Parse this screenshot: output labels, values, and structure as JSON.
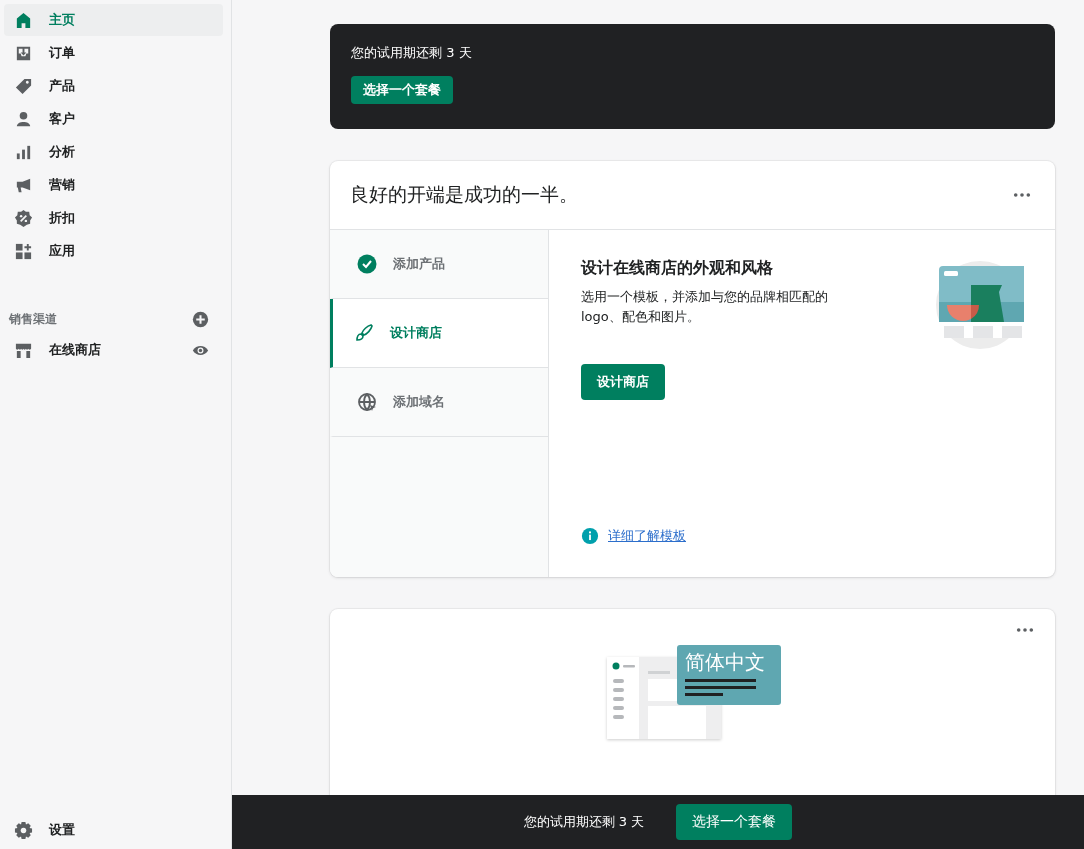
{
  "sidebar": {
    "items": [
      {
        "label": "主页",
        "selected": true
      },
      {
        "label": "订单",
        "selected": false
      },
      {
        "label": "产品",
        "selected": false
      },
      {
        "label": "客户",
        "selected": false
      },
      {
        "label": "分析",
        "selected": false
      },
      {
        "label": "营销",
        "selected": false
      },
      {
        "label": "折扣",
        "selected": false
      },
      {
        "label": "应用",
        "selected": false
      }
    ],
    "section": {
      "title": "销售渠道",
      "items": [
        {
          "label": "在线商店",
          "selected": false
        }
      ]
    },
    "settings": {
      "label": "设置"
    }
  },
  "trial_banner": {
    "text": "您的试用期还剩 3 天",
    "button": "选择一个套餐"
  },
  "setup_card": {
    "title": "良好的开端是成功的一半。",
    "steps": [
      {
        "label": "添加产品",
        "done": true,
        "selected": false
      },
      {
        "label": "设计商店",
        "done": false,
        "selected": true
      },
      {
        "label": "添加域名",
        "done": false,
        "selected": false
      }
    ],
    "detail": {
      "title": "设计在线商店的外观和风格",
      "body": "选用一个模板，并添加与您的品牌相匹配的 logo、配色和图片。",
      "button": "设计商店",
      "link": "详细了解模板"
    }
  },
  "language_card": {
    "illustration_label": "简体中文"
  },
  "bottom_bar": {
    "text": "您的试用期还剩 3 天",
    "button": "选择一个套餐"
  }
}
